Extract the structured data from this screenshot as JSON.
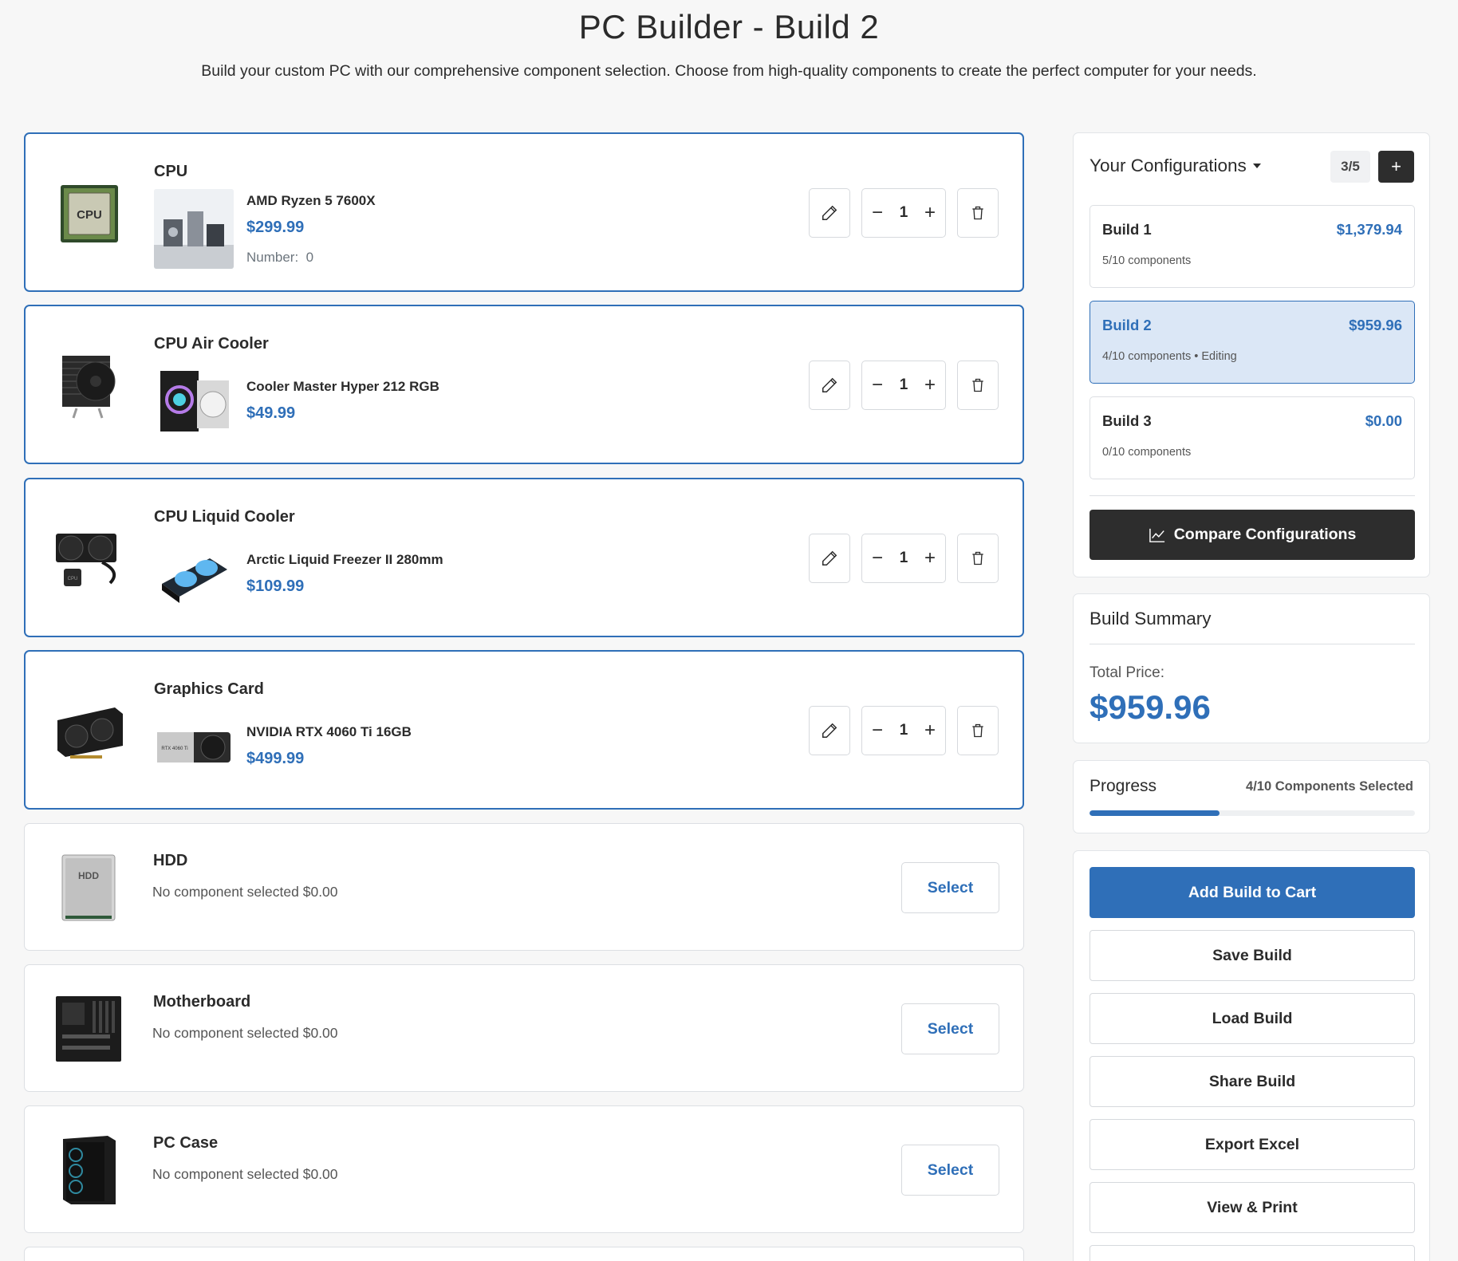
{
  "header": {
    "title": "PC Builder - Build 2",
    "subtitle": "Build your custom PC with our comprehensive component selection. Choose from high-quality components to create the perfect computer for your needs."
  },
  "components": [
    {
      "category": "CPU",
      "product": "AMD Ryzen 5 7600X",
      "price": "$299.99",
      "number_label": "Number:",
      "number_value": "0",
      "quantity": "1",
      "icon": "cpu-icon"
    },
    {
      "category": "CPU Air Cooler",
      "product": "Cooler Master Hyper 212 RGB",
      "price": "$49.99",
      "quantity": "1",
      "icon": "air-cooler-icon"
    },
    {
      "category": "CPU Liquid Cooler",
      "product": "Arctic Liquid Freezer II 280mm",
      "price": "$109.99",
      "quantity": "1",
      "icon": "liquid-cooler-icon"
    },
    {
      "category": "Graphics Card",
      "product": "NVIDIA RTX 4060 Ti 16GB",
      "price": "$499.99",
      "quantity": "1",
      "icon": "graphics-card-icon"
    },
    {
      "category": "HDD",
      "empty_text": "No component selected $0.00",
      "select_label": "Select",
      "icon": "hdd-icon"
    },
    {
      "category": "Motherboard",
      "empty_text": "No component selected $0.00",
      "select_label": "Select",
      "icon": "motherboard-icon"
    },
    {
      "category": "PC Case",
      "empty_text": "No component selected $0.00",
      "select_label": "Select",
      "icon": "pc-case-icon"
    }
  ],
  "configurations": {
    "title": "Your Configurations",
    "count": "3/5",
    "add_label": "+",
    "builds": [
      {
        "name": "Build 1",
        "price": "$1,379.94",
        "meta": "5/10 components",
        "active": false
      },
      {
        "name": "Build 2",
        "price": "$959.96",
        "meta": "4/10 components • Editing",
        "active": true
      },
      {
        "name": "Build 3",
        "price": "$0.00",
        "meta": "0/10 components",
        "active": false
      }
    ],
    "compare_label": "Compare Configurations"
  },
  "summary": {
    "title": "Build Summary",
    "total_label": "Total Price:",
    "total_value": "$959.96"
  },
  "progress": {
    "label": "Progress",
    "count_text": "4/10 Components Selected",
    "fraction": 0.4
  },
  "actions": {
    "add_to_cart": "Add Build to Cart",
    "save": "Save Build",
    "load": "Load Build",
    "share": "Share Build",
    "export": "Export Excel",
    "print": "View & Print"
  },
  "colors": {
    "accent": "#2f6fb8",
    "dark": "#2d2d2d",
    "active_build_bg": "#dbe7f6"
  }
}
